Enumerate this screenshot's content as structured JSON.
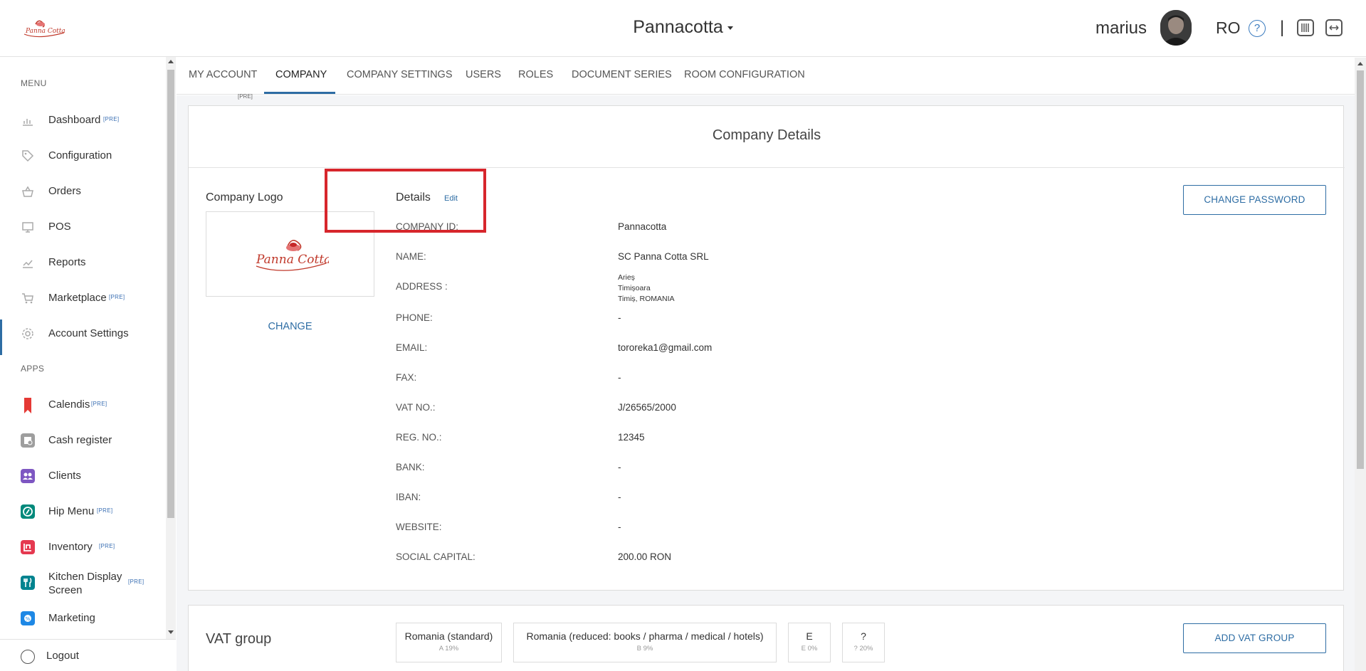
{
  "header": {
    "brand": "Pannacotta",
    "user_name": "marius",
    "language": "RO",
    "help_glyph": "?",
    "separator": "|"
  },
  "sidebar": {
    "menu_title": "MENU",
    "apps_title": "APPS",
    "menu_items": [
      {
        "label": "Dashboard",
        "icon": "bar-chart-icon",
        "badge": "[PRE]"
      },
      {
        "label": "Configuration",
        "icon": "tag-icon"
      },
      {
        "label": "Orders",
        "icon": "basket-icon"
      },
      {
        "label": "POS",
        "icon": "monitor-icon"
      },
      {
        "label": "Reports",
        "icon": "line-chart-icon"
      },
      {
        "label": "Marketplace",
        "icon": "cart-icon",
        "badge": "[PRE]"
      },
      {
        "label": "Account Settings",
        "icon": "gear-icon",
        "active": true
      }
    ],
    "app_items": [
      {
        "label": "Calendis",
        "icon": "bookmark-icon",
        "color": "#e53935",
        "badge": "[PRE]"
      },
      {
        "label": "Cash register",
        "icon": "cash-register-icon",
        "color": "#9e9e9e"
      },
      {
        "label": "Clients",
        "icon": "clients-icon",
        "color": "#7e57c2"
      },
      {
        "label": "Hip Menu",
        "icon": "hipmenu-icon",
        "color": "#00897b",
        "badge": "[PRE]"
      },
      {
        "label": "Inventory",
        "icon": "inventory-icon",
        "color": "#e53950",
        "badge": "[PRE]"
      },
      {
        "label": "Kitchen Display Screen",
        "icon": "kitchen-icon",
        "color": "#00838f",
        "badge": "[PRE]"
      },
      {
        "label": "Marketing",
        "icon": "marketing-icon",
        "color": "#1e88e5"
      }
    ],
    "logout": "Logout"
  },
  "tabs": [
    {
      "label": "MY ACCOUNT"
    },
    {
      "label": "COMPANY",
      "active": true
    },
    {
      "label": "COMPANY SETTINGS"
    },
    {
      "label": "USERS"
    },
    {
      "label": "ROLES"
    },
    {
      "label": "DOCUMENT SERIES"
    },
    {
      "label": "ROOM CONFIGURATION"
    }
  ],
  "tab_badge": "[PRE]",
  "company": {
    "card_title": "Company Details",
    "logo_title": "Company Logo",
    "logo_text": "Panna Cotta",
    "change_label": "CHANGE",
    "details_title": "Details",
    "edit_label": "Edit",
    "change_password_label": "CHANGE PASSWORD",
    "fields": [
      {
        "label": "COMPANY ID:",
        "value": "Pannacotta"
      },
      {
        "label": "NAME:",
        "value": "SC Panna Cotta SRL"
      },
      {
        "label": "ADDRESS :",
        "value": ""
      },
      {
        "label": "PHONE:",
        "value": "-"
      },
      {
        "label": "EMAIL:",
        "value": "tororeka1@gmail.com"
      },
      {
        "label": "FAX:",
        "value": "-"
      },
      {
        "label": "VAT NO.:",
        "value": "J/26565/2000"
      },
      {
        "label": "REG. NO.:",
        "value": "12345"
      },
      {
        "label": "BANK:",
        "value": "-"
      },
      {
        "label": "IBAN:",
        "value": "-"
      },
      {
        "label": "WEBSITE:",
        "value": "-"
      },
      {
        "label": "SOCIAL CAPITAL:",
        "value": "200.00 RON"
      }
    ],
    "address_lines": [
      "Arieș",
      "Timișoara",
      "Timiș, ROMANIA"
    ]
  },
  "vat": {
    "title": "VAT group",
    "add_label": "ADD VAT GROUP",
    "chips": [
      {
        "name": "Romania (standard)",
        "sub": "A 19%"
      },
      {
        "name": "Romania (reduced: books / pharma / medical / hotels)",
        "sub": "B 9%"
      },
      {
        "name": "E",
        "sub": "E 0%"
      },
      {
        "name": "?",
        "sub": "? 20%"
      }
    ]
  }
}
